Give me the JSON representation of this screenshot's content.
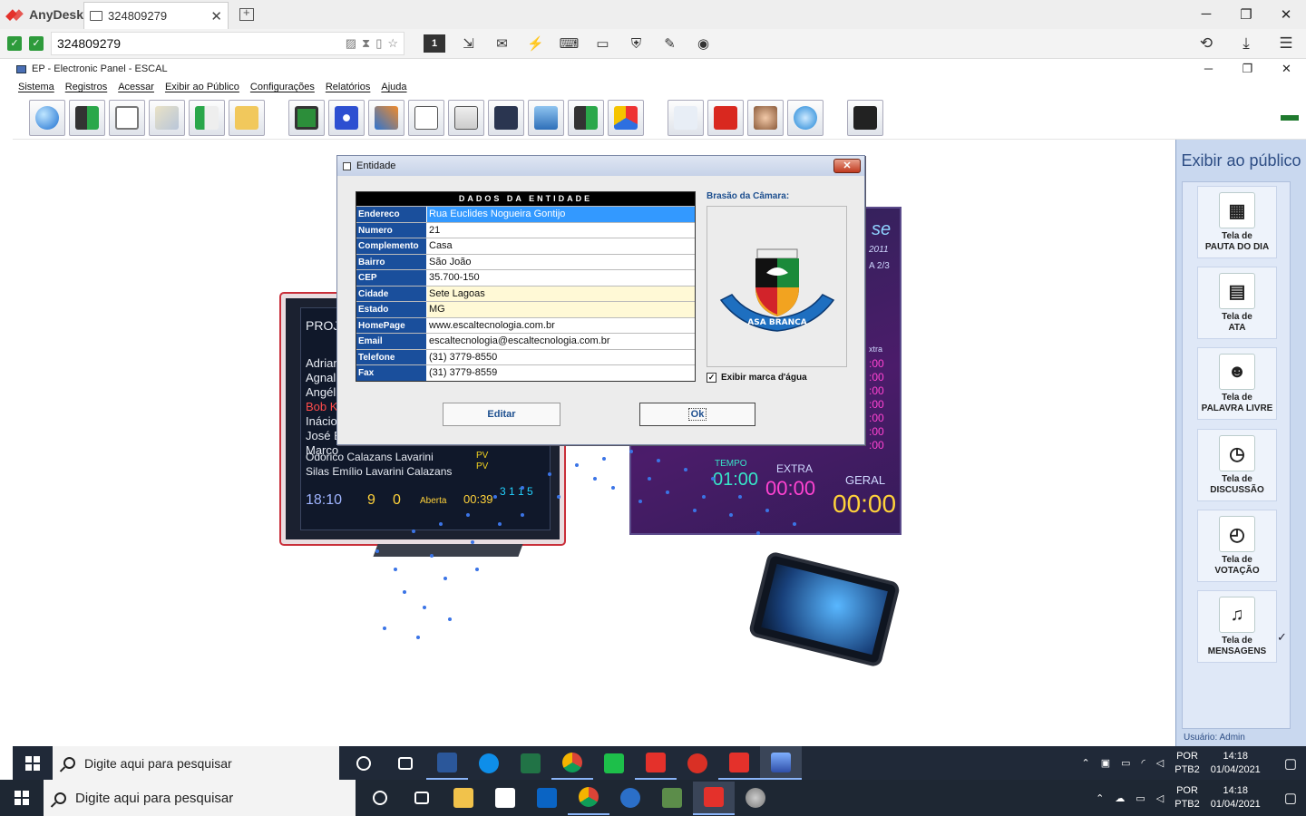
{
  "anydesk": {
    "brand": "AnyDesk",
    "tab_label": "324809279",
    "tab_close": "✕",
    "address_value": "324809279",
    "session_indicator": "1",
    "minimize": "─",
    "maximize": "❐",
    "close": "✕"
  },
  "app": {
    "window_title": "EP - Electronic Panel - ESCAL",
    "minimize": "─",
    "maximize": "❐",
    "close": "✕",
    "menu": [
      "Sistema",
      "Registros",
      "Acessar",
      "Exibir ao Público",
      "Configurações",
      "Relatórios",
      "Ajuda"
    ]
  },
  "dialog": {
    "title": "Entidade",
    "close": "✕",
    "grid_header": "DADOS DA ENTIDADE",
    "fields": [
      {
        "label": "Endereco",
        "value": "Rua Euclides Nogueira Gontijo"
      },
      {
        "label": "Numero",
        "value": "21"
      },
      {
        "label": "Complemento",
        "value": "Casa"
      },
      {
        "label": "Bairro",
        "value": "São João"
      },
      {
        "label": "CEP",
        "value": "35.700-150"
      },
      {
        "label": "Cidade",
        "value": "Sete Lagoas"
      },
      {
        "label": "Estado",
        "value": "MG"
      },
      {
        "label": "HomePage",
        "value": "www.escaltecnologia.com.br"
      },
      {
        "label": "Email",
        "value": "escaltecnologia@escaltecnologia.com.br"
      },
      {
        "label": "Telefone",
        "value": "(31) 3779-8550"
      },
      {
        "label": "Fax",
        "value": "(31) 3779-8559"
      }
    ],
    "brasao_label": "Brasão da Câmara:",
    "brasao_banner": "ASA BRANCA",
    "watermark_checkbox": "Exibir marca d'água",
    "edit_button": "Editar",
    "ok_button": "Ok"
  },
  "side_panel": {
    "title": "Exibir ao público",
    "items": [
      {
        "line1": "Tela de",
        "line2": "PAUTA DO DIA",
        "icon": "calendar-icon"
      },
      {
        "line1": "Tela de",
        "line2": "ATA",
        "icon": "document-icon"
      },
      {
        "line1": "Tela de",
        "line2": "PALAVRA LIVRE",
        "icon": "people-icon"
      },
      {
        "line1": "Tela de",
        "line2": "DISCUSSÃO",
        "icon": "stopwatch-icon"
      },
      {
        "line1": "Tela de",
        "line2": "VOTAÇÃO",
        "icon": "clock-icon"
      },
      {
        "line1": "Tela de",
        "line2": "MENSAGENS",
        "icon": "speaker-icon"
      }
    ],
    "user": "Usuário: Admin"
  },
  "background_art": {
    "tv": {
      "proj": "PROJE",
      "names": [
        "Adrian",
        "Agnal",
        "Angél",
        "Bob K",
        "Inácio",
        "José E",
        "Marco"
      ],
      "line_big1": "Odorico Calazans Lavarini",
      "line_big2": "Silas Emílio Lavarini Calazans",
      "pv": "PV",
      "clock": "18:10",
      "pres": "9",
      "aus": "0",
      "status": "Aberta",
      "tempo": "00:39",
      "votes": "3  1  1  5"
    },
    "board": {
      "se": "se",
      "year": "2011",
      "a23": "A 2/3",
      "xtra": "xtra",
      "zero": ":00",
      "tempo": "TEMPO",
      "t01": "01:00",
      "extra": "EXTRA",
      "e00": "00:00",
      "geral": "GERAL",
      "g00": "00:00"
    }
  },
  "taskbar_inner": {
    "search_placeholder": "Digite aqui para pesquisar",
    "lang1": "POR",
    "lang2": "PTB2",
    "time": "14:18",
    "date": "01/04/2021"
  },
  "taskbar_outer": {
    "search_placeholder": "Digite aqui para pesquisar",
    "lang1": "POR",
    "lang2": "PTB2",
    "time": "14:18",
    "date": "01/04/2021"
  },
  "colors": {
    "grid_label_bg": "#1a4f9c",
    "selection": "#3399ff",
    "side_panel": "#c9d8ef",
    "anydesk_red": "#e4312b",
    "taskbar": "#202938"
  }
}
